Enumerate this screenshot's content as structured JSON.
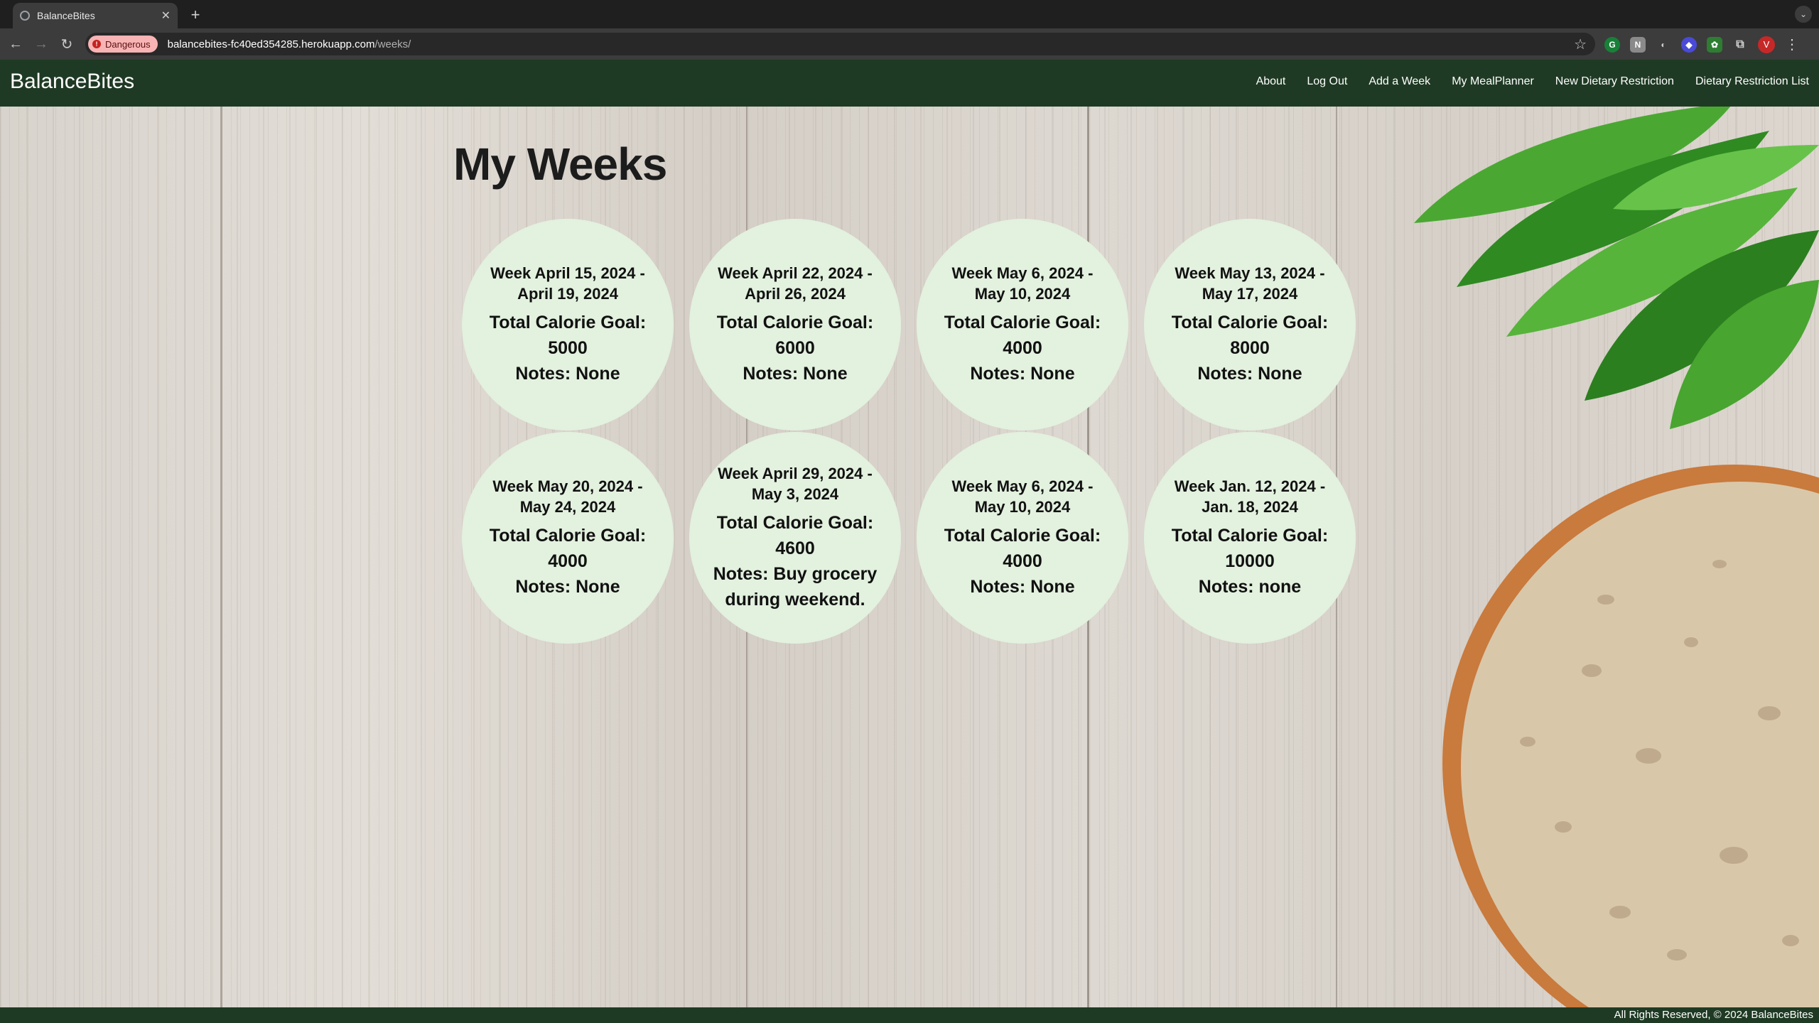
{
  "browser": {
    "tab_title": "BalanceBites",
    "security_chip": "Dangerous",
    "url_host": "balancebites-fc40ed354285.herokuapp.com",
    "url_path": "/weeks/",
    "profile_initial": "V"
  },
  "nav": {
    "brand": "BalanceBites",
    "links": [
      "About",
      "Log Out",
      "Add a Week",
      "My MealPlanner",
      "New Dietary Restriction",
      "Dietary Restriction List"
    ]
  },
  "main": {
    "title": "My Weeks",
    "goal_label": "Total Calorie Goal:",
    "weeks": [
      {
        "range": "Week April 15, 2024 - April 19, 2024",
        "goal": "5000",
        "notes": "Notes: None"
      },
      {
        "range": "Week April 22, 2024 - April 26, 2024",
        "goal": "6000",
        "notes": "Notes: None"
      },
      {
        "range": "Week May 6, 2024 - May 10, 2024",
        "goal": "4000",
        "notes": "Notes: None"
      },
      {
        "range": "Week May 13, 2024 - May 17, 2024",
        "goal": "8000",
        "notes": "Notes: None"
      },
      {
        "range": "Week May 20, 2024 - May 24, 2024",
        "goal": "4000",
        "notes": "Notes: None"
      },
      {
        "range": "Week April 29, 2024 - May 3, 2024",
        "goal": "4600",
        "notes": "Notes: Buy grocery during weekend."
      },
      {
        "range": "Week May 6, 2024 - May 10, 2024",
        "goal": "4000",
        "notes": "Notes: None"
      },
      {
        "range": "Week Jan. 12, 2024 - Jan. 18, 2024",
        "goal": "10000",
        "notes": "Notes: none"
      }
    ]
  },
  "footer": {
    "text": "All Rights Reserved, © 2024 BalanceBites"
  },
  "colors": {
    "nav_bg": "#1f3a24",
    "card_bg": "#e3f1df",
    "danger_chip": "#f8b4b4"
  }
}
